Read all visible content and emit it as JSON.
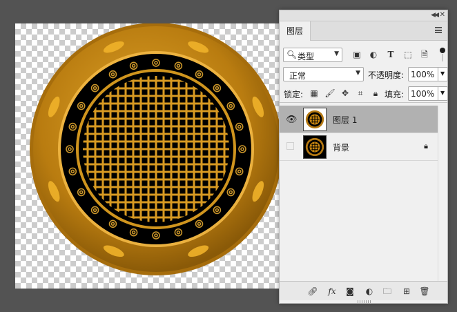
{
  "panel": {
    "tab_label": "图层",
    "filter": {
      "value": "类型",
      "icons": [
        "image-filter-icon",
        "adjustment-filter-icon",
        "type-filter-icon",
        "shape-filter-icon",
        "smart-object-filter-icon"
      ]
    },
    "blend_mode": "正常",
    "opacity_label": "不透明度:",
    "opacity_value": "100%",
    "lock_label": "锁定:",
    "fill_label": "填充:",
    "fill_value": "100%",
    "layers": [
      {
        "name": "图层 1",
        "visible": true,
        "selected": true,
        "locked": false
      },
      {
        "name": "背景",
        "visible": false,
        "selected": false,
        "locked": true
      }
    ],
    "bottom_icons": [
      "link-layers-icon",
      "fx-icon",
      "add-mask-icon",
      "adjustment-layer-icon",
      "new-group-icon",
      "new-layer-icon",
      "delete-icon"
    ],
    "fx_label": "fx"
  },
  "colors": {
    "gold": "#c8860f",
    "gold_dark": "#8a5a0a",
    "black": "#000000",
    "selected_layer": "#b1b1b1"
  }
}
